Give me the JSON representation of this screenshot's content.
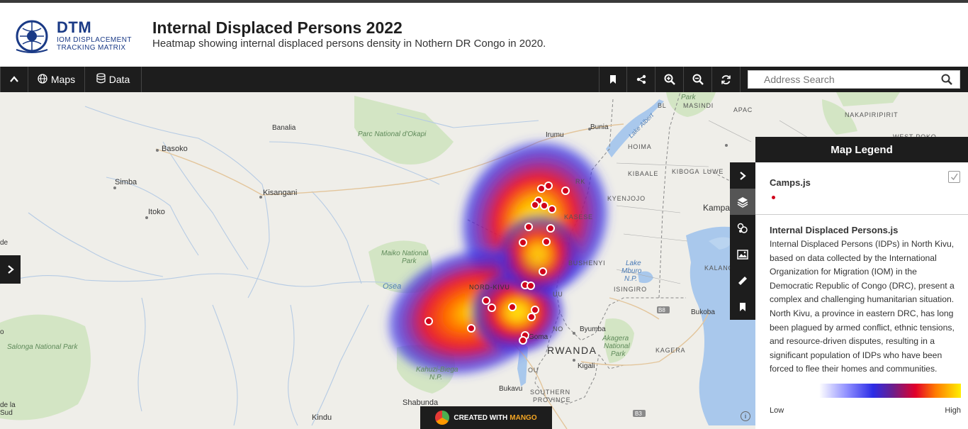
{
  "header": {
    "logo_text": "DTM",
    "logo_sub1": "IOM DISPLACEMENT",
    "logo_sub2": "TRACKING MATRIX",
    "title": "Internal Displaced Persons 2022",
    "subtitle": "Heatmap showing internal displaced persons density in Nothern DR Congo in 2020."
  },
  "toolbar": {
    "maps_label": "Maps",
    "data_label": "Data",
    "search_placeholder": "Address Search"
  },
  "map": {
    "labels": {
      "banalia": "Banalia",
      "parc_okapi": "Parc National d'Okapi",
      "irumu": "Irumu",
      "bunia": "Bunia",
      "lake_albert": "Lake Albert",
      "basoko": "Basoko",
      "simba": "Simba",
      "kisangani": "Kisangani",
      "itoko": "Itoko",
      "maiko": "Maiko National",
      "maiko2": "Park",
      "osea": "Osea",
      "nord_kivu": "NORD-KIVU",
      "salonga": "Salonga National Park",
      "kahuzi": "Kahuzi-Biega",
      "kahuzi2": "N.P.",
      "goma": "Goma",
      "bukavu": "Bukavu",
      "shabunda": "Shabunda",
      "kindu": "Kindu",
      "rwanda": "RWANDA",
      "byumba": "Byumba",
      "kigali": "Kigali",
      "akagera": "Akagera",
      "akagera2": "National",
      "akagera3": "Park",
      "southern": "SOUTHERN",
      "province": "PROVINCE",
      "bukoba": "Bukoba",
      "kampala": "Kampa",
      "masindi": "MASINDI",
      "park_top": "Park",
      "apac": "APAC",
      "nakapiripirit": "NAKAPIRIPIRIT",
      "west_pokot": "WEST POKO",
      "hoima": "HOIMA",
      "kibaale": "KIBAALE",
      "kiboga": "KIBOGA",
      "luwero": "LUWE",
      "kyenjojo": "KYENJOJO",
      "kasese": "KASESE",
      "bushenyi": "BUSHENYI",
      "lake_mburo": "Lake",
      "lake_mburo2": "Mburo",
      "lake_mburo3": "N.P.",
      "isingiro": "ISINGIRO",
      "kagera": "KAGERA",
      "kalanga": "KALANG",
      "bl": "BL",
      "ra": "RA",
      "rk": "RK",
      "uu": "UU",
      "no": "NO",
      "ou": "OU",
      "b8": "B8",
      "b3": "B3",
      "de_left": "de",
      "la_left": "de la",
      "sud_left": "Sud",
      "o_left": "o"
    }
  },
  "legend": {
    "title": "Map Legend",
    "camps_label": "Camps.js",
    "idp_title": "Internal Displaced Persons.js",
    "description": "Internal Displaced Persons (IDPs) in North Kivu, based on data collected by the International Organization for Migration (IOM) in the Democratic Republic of Congo (DRC), present a complex and challenging humanitarian situation. North Kivu, a province in eastern DRC, has long been plagued by armed conflict, ethnic tensions, and resource-driven disputes, resulting in a significant population of IDPs who have been forced to flee their homes and communities.",
    "low": "Low",
    "high": "High"
  },
  "footer": {
    "created_with": "CREATED WITH",
    "mango": "MANGO",
    "attribution": "i"
  },
  "colors": {
    "toolbar_bg": "#1d1d1d",
    "brand_blue": "#1a3a86",
    "camp_marker": "#d0021b",
    "water": "#a9c8ec",
    "park": "#cfe3c0"
  },
  "icons": {
    "collapse": "chevron-up-icon",
    "maps": "globe-icon",
    "data": "database-icon",
    "bookmark": "bookmark-icon",
    "share": "share-icon",
    "zoom_in": "zoom-in-icon",
    "zoom_out": "zoom-out-icon",
    "refresh": "refresh-icon",
    "search": "search-icon"
  }
}
